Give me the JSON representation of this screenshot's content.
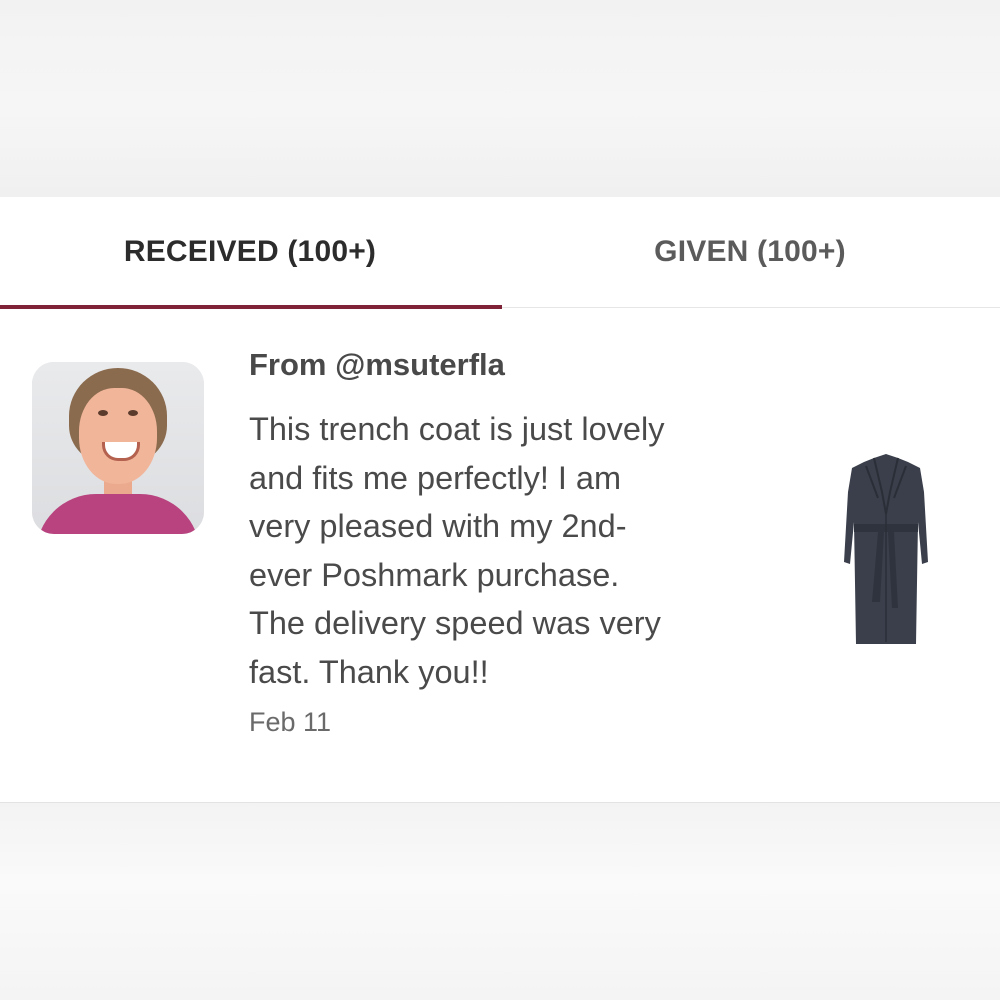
{
  "tabs": {
    "received_label": "RECEIVED (100+)",
    "given_label": "GIVEN (100+)",
    "active": "received"
  },
  "review": {
    "from_text": "From @msuterfla",
    "message_lines": [
      "This trench coat is just lovely",
      "and fits me perfectly! I am",
      "very pleased with my 2nd-",
      "ever Poshmark purchase.",
      "The delivery speed was very",
      "fast. Thank you!!"
    ],
    "date": "Feb 11",
    "avatar_icon": "user-avatar-photo",
    "product_icon": "trench-coat-thumbnail"
  },
  "colors": {
    "accent": "#7f2238",
    "text_primary": "#2c2c2c",
    "text_secondary": "#5b5b5b",
    "coat": "#3a3f4b"
  }
}
